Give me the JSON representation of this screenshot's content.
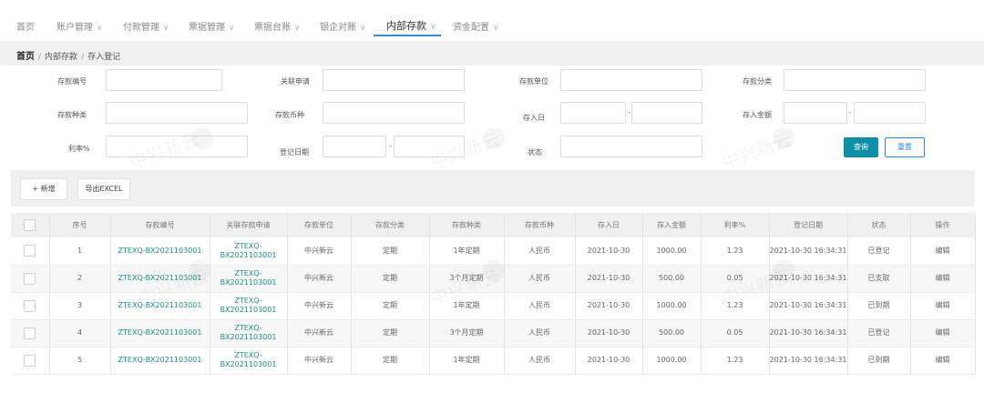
{
  "nav": {
    "items": [
      {
        "label": "首页",
        "chevron": false
      },
      {
        "label": "账户管理",
        "chevron": true
      },
      {
        "label": "付款管理",
        "chevron": true
      },
      {
        "label": "票据管理",
        "chevron": true
      },
      {
        "label": "票据台账",
        "chevron": true
      },
      {
        "label": "银企对账",
        "chevron": true
      },
      {
        "label": "内部存款",
        "chevron": true,
        "active": true
      },
      {
        "label": "资金配置",
        "chevron": true
      }
    ],
    "chevron_glyph": "∨"
  },
  "breadcrumb": {
    "home": "首页",
    "sep": "/",
    "level1": "内部存款",
    "level2": "存入登记"
  },
  "filters": {
    "deposit_no": "存款编号",
    "related_apply": "关联申请",
    "deposit_unit": "存款单位",
    "deposit_category": "存款分类",
    "deposit_type": "存款种类",
    "currency": "存款币种",
    "deposit_date": "存入日",
    "deposit_amount": "存入金额",
    "rate": "利率%",
    "register_date": "登记日期",
    "status": "状态",
    "range_sep": "-"
  },
  "buttons": {
    "query": "查询",
    "reset": "重置",
    "add": "+ 新增",
    "export": "导出EXCEL"
  },
  "table": {
    "headers": [
      "序号",
      "存款编号",
      "关联存款申请",
      "存款单位",
      "存款分类",
      "存款种类",
      "存款币种",
      "存入日",
      "存入金额",
      "利率%",
      "登记日期",
      "状态",
      "操作"
    ],
    "rows": [
      {
        "no": "1",
        "code": "ZTEXQ-BX2021103001",
        "apply1": "ZTEXQ-",
        "apply2": "BX2021103001",
        "unit": "中兴新云",
        "category": "定期",
        "kind": "1年定期",
        "currency": "人民币",
        "date": "2021-10-30",
        "amount": "1000.00",
        "rate": "1.23",
        "reg": "2021-10-30 16:34:31",
        "status": "已登记",
        "op": "编辑",
        "op_active": true
      },
      {
        "no": "2",
        "code": "ZTEXQ-BX2021103001",
        "apply1": "ZTEXQ-",
        "apply2": "BX2021103001",
        "unit": "中兴新云",
        "category": "定期",
        "kind": "3个月定期",
        "currency": "人民币",
        "date": "2021-10-30",
        "amount": "500.00",
        "rate": "0.05",
        "reg": "2021-10-30 16:34:31",
        "status": "已支取",
        "op": "编辑",
        "op_active": false
      },
      {
        "no": "3",
        "code": "ZTEXQ-BX2021103001",
        "apply1": "ZTEXQ-",
        "apply2": "BX2021103001",
        "unit": "中兴新云",
        "category": "定期",
        "kind": "1年定期",
        "currency": "人民币",
        "date": "2021-10-30",
        "amount": "1000.00",
        "rate": "1.23",
        "reg": "2021-10-30 16:34:31",
        "status": "已到期",
        "op": "编辑",
        "op_active": false
      },
      {
        "no": "4",
        "code": "ZTEXQ-BX2021103001",
        "apply1": "ZTEXQ-",
        "apply2": "BX2021103001",
        "unit": "中兴新云",
        "category": "定期",
        "kind": "3个月定期",
        "currency": "人民币",
        "date": "2021-10-30",
        "amount": "500.00",
        "rate": "0.05",
        "reg": "2021-10-30 16:34:31",
        "status": "已登记",
        "op": "编辑",
        "op_active": true
      },
      {
        "no": "5",
        "code": "ZTEXQ-BX2021103001",
        "apply1": "ZTEXQ-",
        "apply2": "BX2021103001",
        "unit": "中兴新云",
        "category": "定期",
        "kind": "1年定期",
        "currency": "人民币",
        "date": "2021-10-30",
        "amount": "1000.00",
        "rate": "1.23",
        "reg": "2021-10-30 16:34:31",
        "status": "已到期",
        "op": "编辑",
        "op_active": false
      }
    ]
  },
  "watermark": {
    "text": "中兴新云"
  },
  "colors": {
    "accent": "#2f8fd6",
    "primary_button": "#0d8fa8",
    "link": "#1c8f86"
  }
}
